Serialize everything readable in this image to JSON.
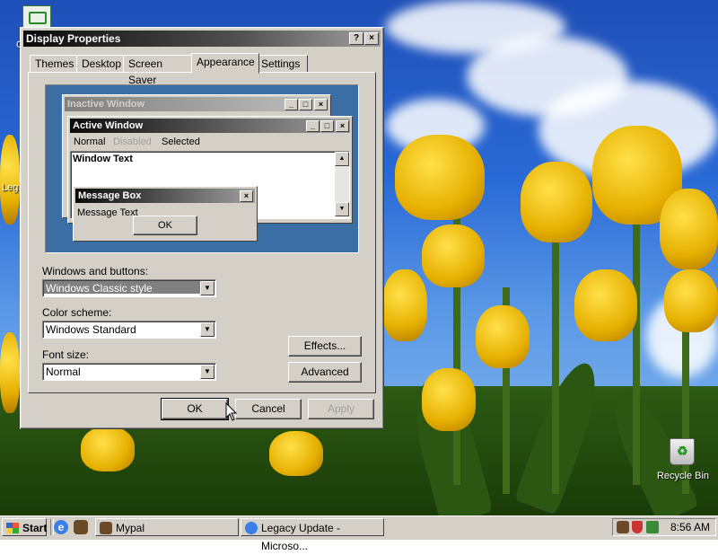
{
  "window": {
    "title": "Display Properties",
    "title_buttons": [
      "?",
      "×"
    ],
    "tabs": [
      "Themes",
      "Desktop",
      "Screen Saver",
      "Appearance",
      "Settings"
    ],
    "active_tab": "Appearance"
  },
  "preview": {
    "inactive_title": "Inactive Window",
    "active_title": "Active Window",
    "menu": [
      "Normal",
      "Disabled",
      "Selected"
    ],
    "window_text": "Window Text",
    "msg_title": "Message Box",
    "msg_text": "Message Text",
    "msg_ok": "OK"
  },
  "form": {
    "windows_buttons_label": "Windows and buttons:",
    "windows_buttons_value": "Windows Classic style",
    "color_scheme_label": "Color scheme:",
    "color_scheme_value": "Windows Standard",
    "font_size_label": "Font size:",
    "font_size_value": "Normal",
    "effects": "Effects...",
    "advanced": "Advanced"
  },
  "buttons": {
    "ok": "OK",
    "cancel": "Cancel",
    "apply": "Apply"
  },
  "desktop": {
    "icon_legacy_partial": "Leg",
    "icon_partial_top": "C",
    "recycle_bin": "Recycle Bin"
  },
  "taskbar": {
    "start": "Start",
    "tasks": [
      "Mypal",
      "Legacy Update - Microso..."
    ],
    "clock": "8:56 AM"
  },
  "colors": {
    "active_title_start": "#0a0a0a",
    "active_title_end": "#a0a0a0",
    "inactive_title": "#808080",
    "face": "#d4d0c8",
    "preview_bg": "#3a6ea5"
  }
}
